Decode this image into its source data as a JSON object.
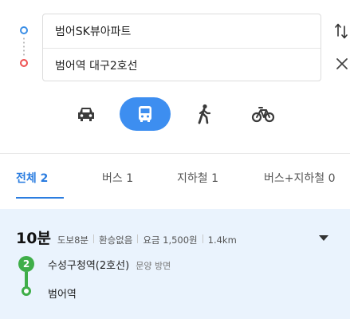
{
  "route": {
    "origin": "범어SK뷰아파트",
    "destination": "범어역 대구2호선"
  },
  "transport_modes": [
    {
      "name": "car",
      "icon": "car-icon",
      "active": false
    },
    {
      "name": "bus",
      "icon": "bus-icon",
      "active": true
    },
    {
      "name": "walk",
      "icon": "walk-icon",
      "active": false
    },
    {
      "name": "bike",
      "icon": "bike-icon",
      "active": false
    }
  ],
  "tabs": [
    {
      "label": "전체 2",
      "active": true
    },
    {
      "label": "버스 1",
      "active": false
    },
    {
      "label": "지하철 1",
      "active": false
    },
    {
      "label": "버스+지하철 0",
      "active": false
    }
  ],
  "result": {
    "time": "10분",
    "walk": "도보8분",
    "transfer": "환승없음",
    "fare": "요금 1,500원",
    "distance": "1.4km",
    "line_number": "2",
    "board_station": "수성구청역(2호선)",
    "direction": "문양 방면",
    "alight_station": "범어역"
  },
  "colors": {
    "accent": "#3d8ef0",
    "origin": "#3a8ee6",
    "destination": "#ee5050",
    "line2": "#3fae49",
    "result_bg": "#eaf3fd"
  }
}
